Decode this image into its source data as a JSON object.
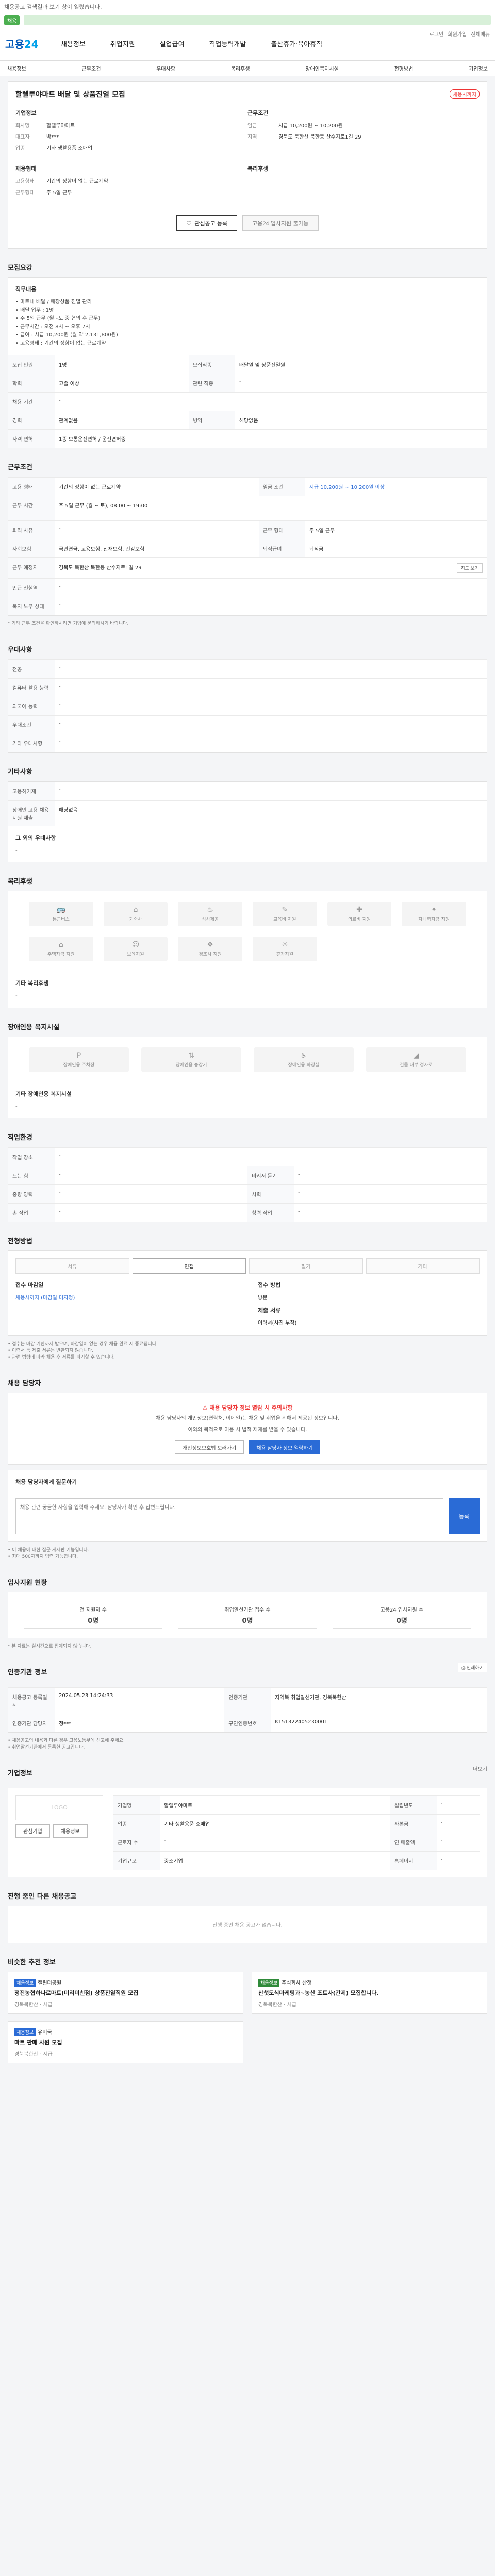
{
  "topbar": {
    "notice": "채용공고 검색결과 보기 창이 열렸습니다."
  },
  "greenbar": {
    "pill": "채용"
  },
  "gnb": {
    "logo_main": "고용",
    "logo_sub": "24",
    "menu": [
      "채용정보",
      "취업지원",
      "실업급여",
      "직업능력개발",
      "출산휴가·육아휴직"
    ],
    "util": [
      "로그인",
      "회원가입",
      "전체메뉴"
    ]
  },
  "subnav": [
    "채용정보",
    "근무조건",
    "우대사항",
    "복리후생",
    "장애인복지시설",
    "전형방법",
    "기업정보"
  ],
  "job": {
    "title": "할렐루야마트 배달 및 상품진열 모집",
    "badge": "채용시까지",
    "company_label": "기업정보",
    "company_rows": [
      {
        "k": "회사명",
        "v": "할렐루야마트"
      },
      {
        "k": "대표자",
        "v": "박***"
      },
      {
        "k": "업종",
        "v": "기타 생활용품 소매업"
      }
    ],
    "work_label": "근무조건",
    "work_rows": [
      {
        "k": "임금",
        "v": "시급 10,200원 ~ 10,200원"
      },
      {
        "k": "지역",
        "v": "경북도 북한산 북한동 산수지로1길 29"
      }
    ],
    "recruit_label": "채용형태",
    "recruit_rows": [
      {
        "k": "고용형태",
        "v": "기간의 정함이 없는 근로계약"
      },
      {
        "k": "근무형태",
        "v": "주 5일 근무"
      }
    ],
    "welfare_label": "복리후생",
    "btn_scrap": "관심공고 등록",
    "btn_apply": "고용24 입사지원 불가능"
  },
  "recruit_section": {
    "title": "모집요강",
    "duty_title": "직무내용",
    "duty_lines": [
      "• 마트내 배달 / 매장상품 진열 관리",
      "• 배달 업무 : 1명",
      "• 주 5일 근무 (월~토 중 협의 후 근무)",
      "• 근무시간 : 오전 8시 ~ 오후 7시",
      "• 급여 : 시급 10,200원 (월 약 2,131,800원)",
      "• 고용형태 : 기간의 정함이 없는 근로계약"
    ],
    "rows": [
      [
        {
          "k": "모집 인원",
          "v": "1명"
        },
        {
          "k": "모집직종",
          "v": "배달원 및 상품진열원"
        }
      ],
      [
        {
          "k": "학력",
          "v": "고졸 이상"
        },
        {
          "k": "관련 직종",
          "v": "-"
        }
      ],
      [
        {
          "k": "채용 기간",
          "v": "-"
        },
        {
          "k": "",
          "v": ""
        }
      ],
      [
        {
          "k": "경력",
          "v": "관계없음"
        },
        {
          "k": "병역",
          "v": "해당없음"
        }
      ],
      [
        {
          "k": "자격 면허",
          "v": "1종 보통운전면허 / 운전면허증"
        },
        {
          "k": "",
          "v": ""
        }
      ]
    ]
  },
  "work_section": {
    "title": "근무조건",
    "rows": [
      [
        {
          "k": "고용 형태",
          "v": "기간의 정함이 없는 근로계약"
        },
        {
          "k": "임금 조건",
          "v": "시급 10,200원 ~ 10,200원 이상"
        }
      ],
      [
        {
          "k": "근무 시간",
          "v": "주 5일 근무 (월 ~ 토), 08:00 ~ 19:00"
        },
        {
          "k": "",
          "v": ""
        }
      ],
      [
        {
          "k": "퇴직 사유",
          "v": "-"
        },
        {
          "k": "근무 형태",
          "v": "주 5일 근무"
        }
      ],
      [
        {
          "k": "사회보험",
          "v": "국민연금, 고용보험, 산재보험, 건강보험"
        },
        {
          "k": "퇴직급여",
          "v": "퇴직금"
        }
      ],
      [
        {
          "k": "근무 예정지",
          "v": "경북도 북한산 북한동 산수지로1길 29"
        },
        {
          "k": "",
          "v": ""
        }
      ],
      [
        {
          "k": "인근 전철역",
          "v": "-"
        },
        {
          "k": "",
          "v": ""
        }
      ],
      [
        {
          "k": "복지 노무 상태",
          "v": "-"
        },
        {
          "k": "",
          "v": ""
        }
      ]
    ],
    "map_btn": "지도 보기",
    "note": "* 기타 근무 조건을 확인하시려면 기업에 문의하시기 바랍니다."
  },
  "pref_section": {
    "title": "우대사항",
    "rows": [
      {
        "k": "전공",
        "v": "-"
      },
      {
        "k": "컴퓨터 활용 능력",
        "v": "-"
      },
      {
        "k": "외국어 능력",
        "v": "-"
      },
      {
        "k": "우대조건",
        "v": "-"
      },
      {
        "k": "기타 우대사항",
        "v": "-"
      }
    ]
  },
  "etc_section": {
    "title": "기타사항",
    "rows": [
      {
        "k": "고용허가제",
        "v": "-"
      },
      {
        "k": "장애인 고용 채용지원 제출",
        "v": "해당없음"
      }
    ],
    "extra_label": "그 외의 우대사항",
    "extra_value": "-"
  },
  "welfare_section": {
    "title": "복리후생",
    "items": [
      "통근버스",
      "기숙사",
      "식사제공",
      "교육비 지원",
      "의료비 지원",
      "자녀학자금 지원",
      "주택자금 지원",
      "보육지원",
      "경조사 지원",
      "휴가지원"
    ],
    "extra_label": "기타 복리후생",
    "extra_value": "-"
  },
  "disabled_section": {
    "title": "장애인용 복지시설",
    "items": [
      "장애인용 주차장",
      "장애인용 승강기",
      "장애인용 화장실",
      "건물 내부 경사로"
    ],
    "extra_label": "기타 장애인용 복지시설",
    "extra_value": "-"
  },
  "job_section": {
    "title": "직업환경",
    "rows": [
      [
        {
          "k": "작업 장소",
          "v": "-"
        },
        {
          "k": "",
          "v": ""
        }
      ],
      [
        {
          "k": "드는 힘",
          "v": "-"
        },
        {
          "k": "비켜서 듣기",
          "v": "-"
        }
      ],
      [
        {
          "k": "중량 양력",
          "v": "-"
        },
        {
          "k": "시력",
          "v": "-"
        }
      ],
      [
        {
          "k": "손 작업",
          "v": "-"
        },
        {
          "k": "청력 작업",
          "v": "-"
        }
      ]
    ]
  },
  "process_section": {
    "title": "전형방법",
    "steps": [
      "서류",
      "면접",
      "필기",
      "기타"
    ],
    "apply_label": "접수 마감일",
    "apply_value": "채용시까지 (마감일 미지정)",
    "method_label": "접수 방법",
    "method_value": "방문",
    "docs_label": "제출 서류",
    "docs_value": "이력서(사진 부착)",
    "notes": [
      "• 접수는 마감 기한까지 받으며, 마감일이 없는 경우 채용 완료 시 종료됩니다.",
      "• 이력서 등 제출 서류는 반환되지 않습니다.",
      "• 관련 법령에 따라 채용 후 서류를 파기할 수 있습니다."
    ]
  },
  "contact_section": {
    "title": "채용 담당자",
    "warn": "채용 담당자 정보 열람 시 주의사항",
    "desc1": "채용 담당자의 개인정보(연락처, 이메일)는 채용 및 취업을 위해서 제공된 정보입니다.",
    "desc2": "이외의 목적으로 이용 시 법적 제재를 받을 수 있습니다.",
    "btn1": "개인정보보호법 보러가기",
    "btn2": "채용 담당자 정보 열람하기",
    "q_title": "채용 담당자에게 질문하기",
    "q_placeholder": "채용 관련 궁금한 사항을 입력해 주세요. 담당자가 확인 후 답변드립니다.",
    "q_btn": "등록",
    "notes": [
      "• 이 채용에 대한 질문 게시판 기능입니다.",
      "• 최대 500자까지 입력 가능합니다."
    ]
  },
  "status_section": {
    "title": "입사지원 현황",
    "stats": [
      {
        "label": "전 지원자 수",
        "value": "0명"
      },
      {
        "label": "취업알선기관 접수 수",
        "value": "0명"
      },
      {
        "label": "고용24 입사지원 수",
        "value": "0명"
      }
    ],
    "note": "* 본 자료는 실시간으로 집계되지 않습니다."
  },
  "info_section": {
    "title": "인증기관 정보",
    "print_btn": "인쇄하기",
    "rows": [
      [
        {
          "k": "채용공고 등록일시",
          "v": "2024.05.23 14:24:33"
        },
        {
          "k": "인증기관",
          "v": "지역북 취업알선기관, 경북북한산"
        }
      ],
      [
        {
          "k": "인증기관 담당자",
          "v": "정***"
        },
        {
          "k": "구인인증번호",
          "v": "K151322405230001"
        }
      ]
    ],
    "notes": [
      "• 채용공고의 내용과 다른 경우 고용노동부에 신고해 주세요.",
      "• 취업알선기관에서 등록한 공고입니다."
    ]
  },
  "company_section": {
    "title": "기업정보",
    "more": "더보기",
    "logo_text": "LOGO",
    "btn1": "관심기업",
    "btn2": "채용정보",
    "rows": [
      [
        {
          "k": "기업명",
          "v": "할렐루야마트"
        },
        {
          "k": "설립년도",
          "v": "-"
        }
      ],
      [
        {
          "k": "업종",
          "v": "기타 생활용품 소매업"
        },
        {
          "k": "자본금",
          "v": "-"
        }
      ],
      [
        {
          "k": "근로자 수",
          "v": "-"
        },
        {
          "k": "연 매출액",
          "v": "-"
        }
      ],
      [
        {
          "k": "기업규모",
          "v": "중소기업"
        },
        {
          "k": "홈페이지",
          "v": "-"
        }
      ]
    ]
  },
  "other_section": {
    "title": "진행 중인 다른 채용공고",
    "empty": "진행 중인 채용 공고가 없습니다."
  },
  "rec_section": {
    "title": "비슷한 추천 정보",
    "items": [
      {
        "tag": "채용정보",
        "org": "캘린더공원",
        "title": "정진농협하나로마트(미리미친점) 상품진열직원 모집",
        "meta": "경북북한산 · 시급"
      },
      {
        "tag": "채용정보",
        "org": "주식회사 산챗",
        "title": "산챗도식마케팅과~농산 조트사(간제) 모집합니다.",
        "meta": "경북북한산 · 시급"
      },
      {
        "tag": "채용정보",
        "org": "유미국",
        "title": "마트 판매 사원 모집",
        "meta": "경북북한산 · 시급"
      }
    ]
  }
}
